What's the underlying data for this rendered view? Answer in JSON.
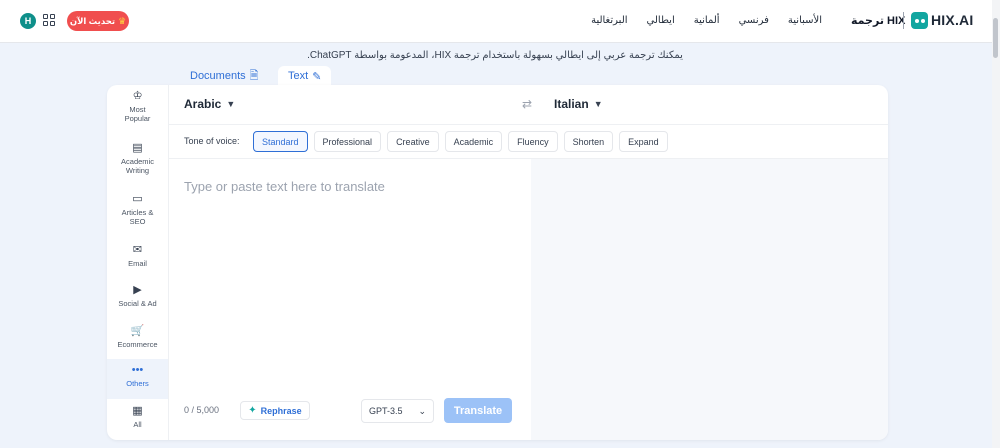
{
  "header": {
    "avatar_letter": "H",
    "upgrade_label": "تحديث الآن",
    "nav": [
      "الأسبانية",
      "فرنسي",
      "ألمانية",
      "ايطالي",
      "البرتغالية"
    ],
    "brand_title": "ترجمة HIX",
    "logo_text": "HIX.AI"
  },
  "subtitle": "يمكنك ترجمة عربي إلى ايطالي بسهولة باستخدام ترجمة HIX، المدعومة بواسطة ChatGPT.",
  "mode_tabs": {
    "documents": "Documents",
    "text": "Text"
  },
  "sidebar": {
    "items": [
      {
        "label_1": "Most",
        "label_2": "Popular",
        "icon": "crown-icon"
      },
      {
        "label_1": "Academic",
        "label_2": "Writing",
        "icon": "notebook-icon"
      },
      {
        "label_1": "Articles &",
        "label_2": "SEO",
        "icon": "browser-icon"
      },
      {
        "label_1": "Email",
        "label_2": "",
        "icon": "email-icon"
      },
      {
        "label_1": "Social & Ad",
        "label_2": "",
        "icon": "monitor-play-icon"
      },
      {
        "label_1": "Ecommerce",
        "label_2": "",
        "icon": "cart-icon"
      },
      {
        "label_1": "Others",
        "label_2": "",
        "icon": "ellipsis-icon"
      },
      {
        "label_1": "All",
        "label_2": "",
        "icon": "grid-icon"
      }
    ]
  },
  "languages": {
    "source": "Arabic",
    "target": "Italian"
  },
  "tone": {
    "label": "Tone of voice:",
    "options": [
      "Standard",
      "Professional",
      "Creative",
      "Academic",
      "Fluency",
      "Shorten",
      "Expand"
    ],
    "selected": "Standard"
  },
  "input": {
    "placeholder": "Type or paste text here to translate",
    "char_count": "0 / 5,000",
    "rephrase_label": "Rephrase",
    "model": "GPT-3.5",
    "translate_label": "Translate"
  },
  "colors": {
    "accent": "#2f6fd6",
    "upgrade": "#f04e4e",
    "brand": "#12a6a0",
    "translate_disabled": "#9cc2f7"
  }
}
